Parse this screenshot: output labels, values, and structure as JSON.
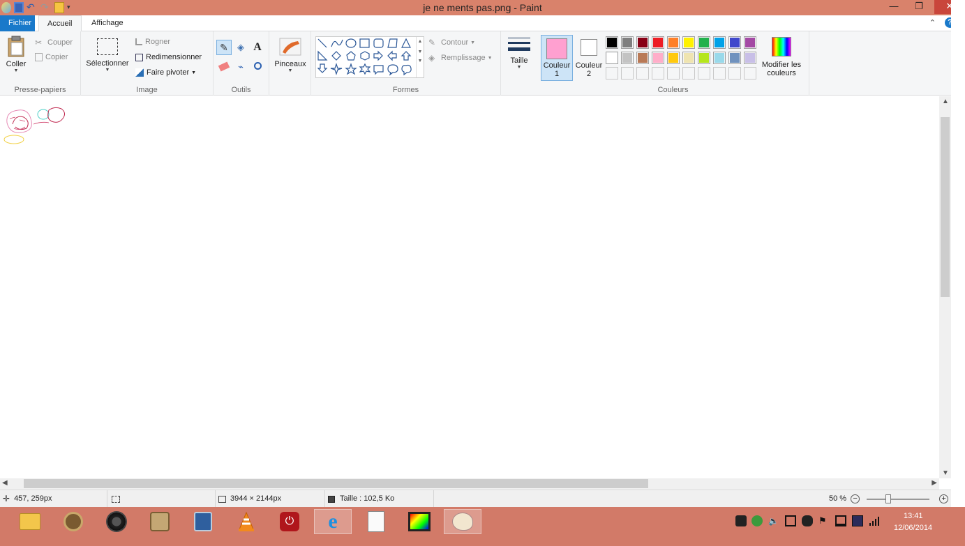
{
  "window": {
    "title": "je ne ments pas.png - Paint",
    "minimize": "—",
    "restore": "❐",
    "close": "✕"
  },
  "tabs": {
    "file": "Fichier",
    "home": "Accueil",
    "view": "Affichage"
  },
  "clipboard": {
    "group": "Presse-papiers",
    "paste": "Coller",
    "cut": "Couper",
    "copy": "Copier"
  },
  "image": {
    "group": "Image",
    "select": "Sélectionner",
    "crop": "Rogner",
    "resize": "Redimensionner",
    "rotate": "Faire pivoter"
  },
  "tools": {
    "group": "Outils"
  },
  "brushes": {
    "label": "Pinceaux"
  },
  "shapes": {
    "group": "Formes",
    "outline": "Contour",
    "fill": "Remplissage"
  },
  "size": {
    "label": "Taille"
  },
  "colors": {
    "group": "Couleurs",
    "color1_line1": "Couleur",
    "color1_line2": "1",
    "color2_line1": "Couleur",
    "color2_line2": "2",
    "edit_line1": "Modifier les",
    "edit_line2": "couleurs",
    "color1_value": "#ffa0d0",
    "color2_value": "#ffffff",
    "palette_row1": [
      "#000000",
      "#7f7f7f",
      "#880015",
      "#ed1c24",
      "#ff7f27",
      "#fff200",
      "#22b14c",
      "#00a2e8",
      "#3f48cc",
      "#a349a4"
    ],
    "palette_row2": [
      "#ffffff",
      "#c3c3c3",
      "#b97a57",
      "#ffaec9",
      "#ffc90e",
      "#efe4b0",
      "#b5e61d",
      "#99d9ea",
      "#7092be",
      "#c8bfe7"
    ]
  },
  "status": {
    "cursor_pos": "457, 259px",
    "image_size": "3944 × 2144px",
    "file_size": "Taille : 102,5 Ko",
    "zoom": "50 %",
    "zoom_level": 0.5
  },
  "taskbar": {
    "time": "13:41",
    "date": "12/06/2014"
  }
}
